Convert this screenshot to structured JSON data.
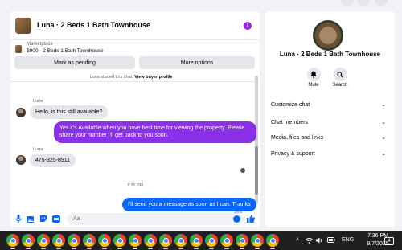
{
  "chat": {
    "header_title": "Luna · 2 Beds 1 Bath Townhouse",
    "marketplace_label": "Marketplace",
    "listing": "$900 - 2 Beds 1 Bath Townhouse",
    "mark_pending_label": "Mark as pending",
    "more_options_label": "More options",
    "started_text": "Luna started this chat.",
    "view_profile_label": "View buyer profile",
    "messages": [
      {
        "sender": "Luna",
        "text": "Hello, is this still available?",
        "direction": "in"
      },
      {
        "text": "Yes it's Available when you have best time for viewing the property..Please share your number I'll get back to you soon.",
        "direction": "out",
        "color": "#8a30e8"
      },
      {
        "sender": "Luna",
        "text": "475-325-8911",
        "direction": "in"
      },
      {
        "text": "I'll send you a message as soon as I can. Thanks",
        "direction": "out",
        "color": "#0866ff"
      }
    ],
    "timestamp": "7:35 PM",
    "sent_label": "Sent",
    "composer_placeholder": "Aa"
  },
  "panel": {
    "title": "Luna · 2 Beds 1 Bath Townhouse",
    "mute_label": "Mute",
    "search_label": "Search",
    "sections": [
      "Customize chat",
      "Chat members",
      "Media, files and links",
      "Privacy & support"
    ]
  },
  "taskbar": {
    "lang": "ENG",
    "time": "7:36 PM",
    "date": "8/7/2025",
    "notifications": "4"
  },
  "colors": {
    "accent_blue": "#0866ff",
    "accent_purple": "#8a30e8"
  },
  "icons": [
    "info-icon",
    "mic-icon",
    "image-icon",
    "sticker-icon",
    "gif-icon",
    "emoji-icon",
    "like-icon",
    "bell-icon",
    "search-icon",
    "chevron-down-icon",
    "chrome-icon"
  ]
}
